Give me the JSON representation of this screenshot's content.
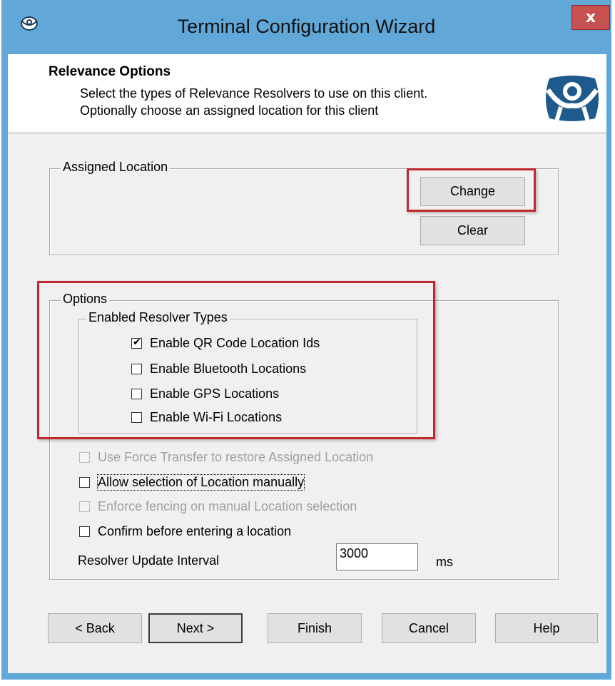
{
  "window": {
    "title": "Terminal Configuration Wizard",
    "close_label": "x"
  },
  "header": {
    "title": "Relevance Options",
    "line1": "Select the types of Relevance Resolvers to use on this client.",
    "line2": "Optionally choose an assigned location for this client"
  },
  "assigned_location": {
    "legend": "Assigned Location",
    "change_label": "Change",
    "clear_label": "Clear"
  },
  "options": {
    "legend": "Options",
    "resolver_types": {
      "legend": "Enabled Resolver Types",
      "items": [
        {
          "label": "Enable QR Code Location Ids",
          "checked": true
        },
        {
          "label": "Enable Bluetooth Locations",
          "checked": false
        },
        {
          "label": "Enable GPS Locations",
          "checked": false
        },
        {
          "label": "Enable Wi-Fi Locations",
          "checked": false
        }
      ]
    },
    "force_transfer": {
      "label": "Use Force Transfer to restore Assigned Location",
      "checked": false,
      "enabled": false
    },
    "allow_manual": {
      "label": "Allow selection of Location manually",
      "checked": false,
      "enabled": true
    },
    "enforce_fencing": {
      "label": "Enforce fencing on manual Location selection",
      "checked": false,
      "enabled": false
    },
    "confirm_before": {
      "label": "Confirm before entering a location",
      "checked": false,
      "enabled": true
    },
    "interval": {
      "label": "Resolver Update Interval",
      "value": "3000",
      "unit": "ms"
    }
  },
  "footer": {
    "back_label": "< Back",
    "next_label": "Next >",
    "finish_label": "Finish",
    "cancel_label": "Cancel",
    "help_label": "Help"
  },
  "colors": {
    "titlebar": "#61a8d8",
    "close": "#c75050",
    "highlight": "#c0282d",
    "logo": "#1e5a8c"
  }
}
